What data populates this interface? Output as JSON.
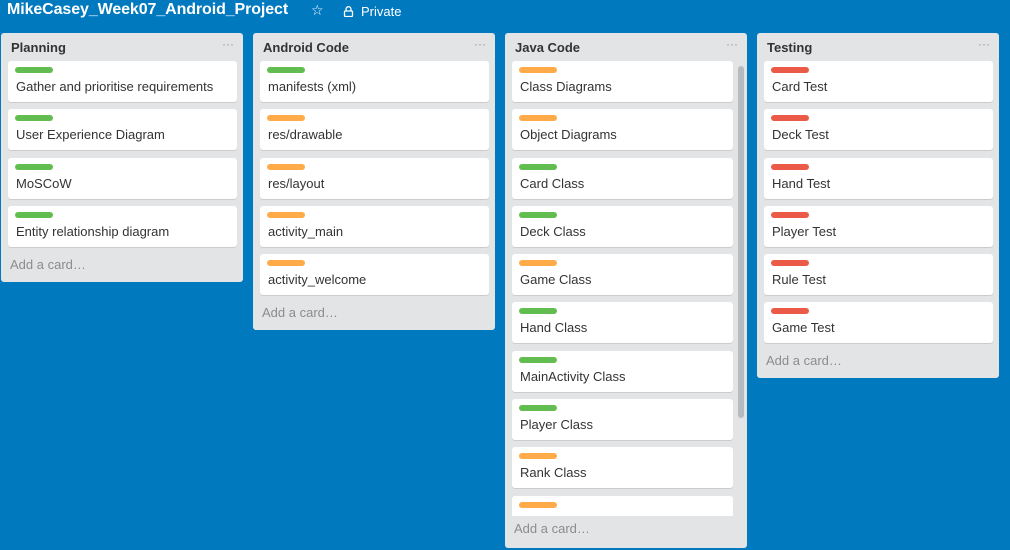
{
  "board": {
    "title": "MikeCasey_Week07_Android_Project",
    "star_icon": "star-icon",
    "privacy_label": "Private",
    "lock_icon": "lock-icon",
    "background_color": "#0079bf"
  },
  "lists": [
    {
      "title": "Planning",
      "menu": "···",
      "add_card": "Add a card…",
      "cards": [
        {
          "label_color": "green",
          "text": "Gather and prioritise requirements"
        },
        {
          "label_color": "green",
          "text": "User Experience Diagram"
        },
        {
          "label_color": "green",
          "text": "MoSCoW"
        },
        {
          "label_color": "green",
          "text": "Entity relationship diagram"
        }
      ]
    },
    {
      "title": "Android Code",
      "menu": "···",
      "add_card": "Add a card…",
      "cards": [
        {
          "label_color": "green",
          "text": "manifests (xml)"
        },
        {
          "label_color": "orange",
          "text": "res/drawable"
        },
        {
          "label_color": "orange",
          "text": "res/layout"
        },
        {
          "label_color": "orange",
          "text": "activity_main"
        },
        {
          "label_color": "orange",
          "text": "activity_welcome"
        }
      ]
    },
    {
      "title": "Java Code",
      "menu": "···",
      "add_card": "Add a card…",
      "cards": [
        {
          "label_color": "orange",
          "text": "Class Diagrams"
        },
        {
          "label_color": "orange",
          "text": "Object Diagrams"
        },
        {
          "label_color": "green",
          "text": "Card Class"
        },
        {
          "label_color": "green",
          "text": "Deck Class"
        },
        {
          "label_color": "orange",
          "text": "Game Class"
        },
        {
          "label_color": "green",
          "text": "Hand Class"
        },
        {
          "label_color": "green",
          "text": "MainActivity Class"
        },
        {
          "label_color": "green",
          "text": "Player Class"
        },
        {
          "label_color": "orange",
          "text": "Rank Class"
        },
        {
          "label_color": "orange",
          "text": ""
        }
      ]
    },
    {
      "title": "Testing",
      "menu": "···",
      "add_card": "Add a card…",
      "cards": [
        {
          "label_color": "red",
          "text": "Card Test"
        },
        {
          "label_color": "red",
          "text": "Deck Test"
        },
        {
          "label_color": "red",
          "text": "Hand Test"
        },
        {
          "label_color": "red",
          "text": "Player Test"
        },
        {
          "label_color": "red",
          "text": "Rule Test"
        },
        {
          "label_color": "red",
          "text": "Game Test"
        }
      ]
    }
  ],
  "label_colors": {
    "green": "#61bd4f",
    "orange": "#ffab4a",
    "red": "#eb5a46"
  }
}
